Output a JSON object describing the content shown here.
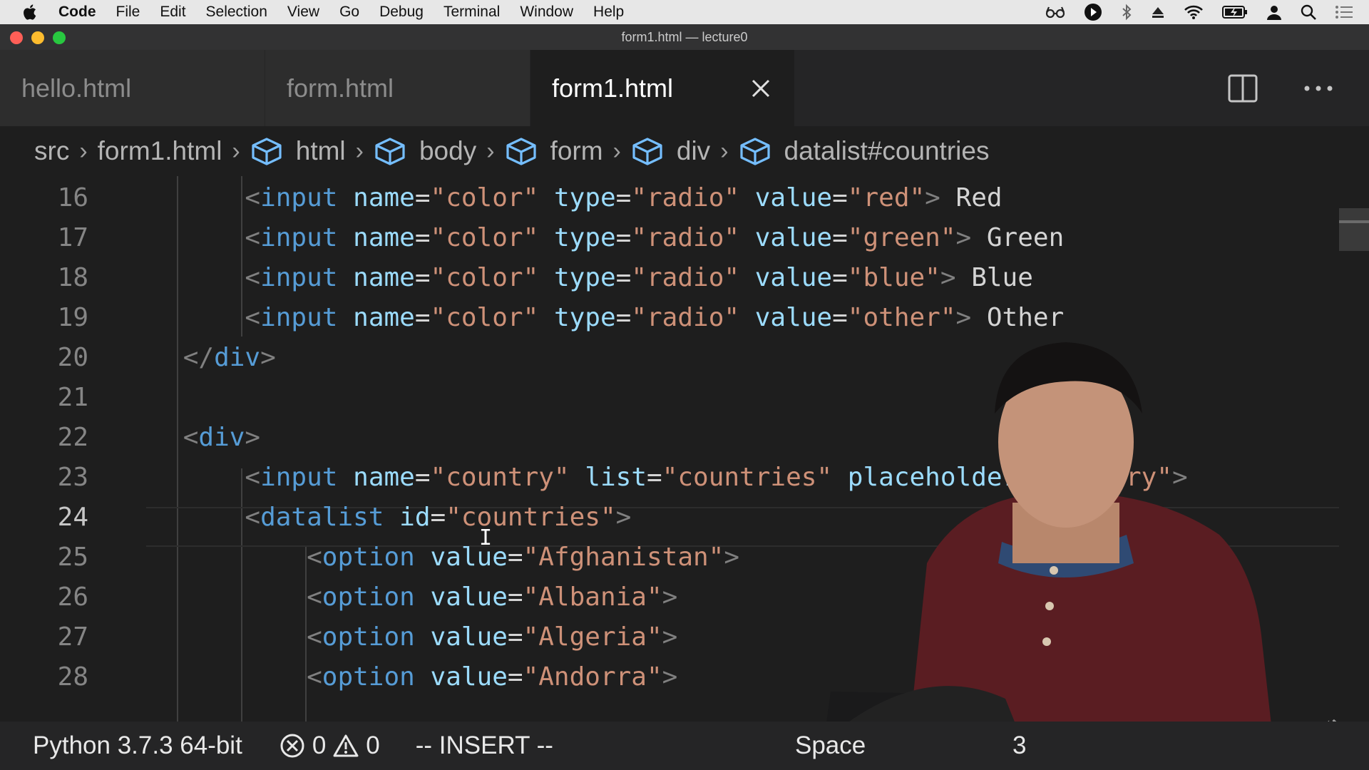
{
  "menubar": {
    "app_name": "Code",
    "items": [
      "File",
      "Edit",
      "Selection",
      "View",
      "Go",
      "Debug",
      "Terminal",
      "Window",
      "Help"
    ]
  },
  "window": {
    "title": "form1.html — lecture0"
  },
  "tabs": [
    {
      "label": "hello.html",
      "active": false
    },
    {
      "label": "form.html",
      "active": false
    },
    {
      "label": "form1.html",
      "active": true
    }
  ],
  "breadcrumb": [
    "src",
    "form1.html",
    "html",
    "body",
    "form",
    "div",
    "datalist#countries"
  ],
  "editor": {
    "current_line": 24,
    "lines": [
      {
        "num": "16",
        "indent": "        ",
        "parts": [
          [
            "punc",
            "<"
          ],
          [
            "tag",
            "input"
          ],
          [
            "txt",
            " "
          ],
          [
            "attr",
            "name"
          ],
          [
            "txt",
            "="
          ],
          [
            "str",
            "\"color\""
          ],
          [
            "txt",
            " "
          ],
          [
            "attr",
            "type"
          ],
          [
            "txt",
            "="
          ],
          [
            "str",
            "\"radio\""
          ],
          [
            "txt",
            " "
          ],
          [
            "attr",
            "value"
          ],
          [
            "txt",
            "="
          ],
          [
            "str",
            "\"red\""
          ],
          [
            "punc",
            ">"
          ],
          [
            "txt",
            " Red"
          ]
        ]
      },
      {
        "num": "17",
        "indent": "        ",
        "parts": [
          [
            "punc",
            "<"
          ],
          [
            "tag",
            "input"
          ],
          [
            "txt",
            " "
          ],
          [
            "attr",
            "name"
          ],
          [
            "txt",
            "="
          ],
          [
            "str",
            "\"color\""
          ],
          [
            "txt",
            " "
          ],
          [
            "attr",
            "type"
          ],
          [
            "txt",
            "="
          ],
          [
            "str",
            "\"radio\""
          ],
          [
            "txt",
            " "
          ],
          [
            "attr",
            "value"
          ],
          [
            "txt",
            "="
          ],
          [
            "str",
            "\"green\""
          ],
          [
            "punc",
            ">"
          ],
          [
            "txt",
            " Green"
          ]
        ]
      },
      {
        "num": "18",
        "indent": "        ",
        "parts": [
          [
            "punc",
            "<"
          ],
          [
            "tag",
            "input"
          ],
          [
            "txt",
            " "
          ],
          [
            "attr",
            "name"
          ],
          [
            "txt",
            "="
          ],
          [
            "str",
            "\"color\""
          ],
          [
            "txt",
            " "
          ],
          [
            "attr",
            "type"
          ],
          [
            "txt",
            "="
          ],
          [
            "str",
            "\"radio\""
          ],
          [
            "txt",
            " "
          ],
          [
            "attr",
            "value"
          ],
          [
            "txt",
            "="
          ],
          [
            "str",
            "\"blue\""
          ],
          [
            "punc",
            ">"
          ],
          [
            "txt",
            " Blue"
          ]
        ]
      },
      {
        "num": "19",
        "indent": "        ",
        "parts": [
          [
            "punc",
            "<"
          ],
          [
            "tag",
            "input"
          ],
          [
            "txt",
            " "
          ],
          [
            "attr",
            "name"
          ],
          [
            "txt",
            "="
          ],
          [
            "str",
            "\"color\""
          ],
          [
            "txt",
            " "
          ],
          [
            "attr",
            "type"
          ],
          [
            "txt",
            "="
          ],
          [
            "str",
            "\"radio\""
          ],
          [
            "txt",
            " "
          ],
          [
            "attr",
            "value"
          ],
          [
            "txt",
            "="
          ],
          [
            "str",
            "\"other\""
          ],
          [
            "punc",
            ">"
          ],
          [
            "txt",
            " Other"
          ]
        ]
      },
      {
        "num": "20",
        "indent": "    ",
        "parts": [
          [
            "punc",
            "</"
          ],
          [
            "tag",
            "div"
          ],
          [
            "punc",
            ">"
          ]
        ]
      },
      {
        "num": "21",
        "indent": "",
        "parts": []
      },
      {
        "num": "22",
        "indent": "    ",
        "parts": [
          [
            "punc",
            "<"
          ],
          [
            "tag",
            "div"
          ],
          [
            "punc",
            ">"
          ]
        ]
      },
      {
        "num": "23",
        "indent": "        ",
        "parts": [
          [
            "punc",
            "<"
          ],
          [
            "tag",
            "input"
          ],
          [
            "txt",
            " "
          ],
          [
            "attr",
            "name"
          ],
          [
            "txt",
            "="
          ],
          [
            "str",
            "\"country\""
          ],
          [
            "txt",
            " "
          ],
          [
            "attr",
            "list"
          ],
          [
            "txt",
            "="
          ],
          [
            "str",
            "\"countries\""
          ],
          [
            "txt",
            " "
          ],
          [
            "attr",
            "placeholder"
          ],
          [
            "txt",
            "="
          ],
          [
            "str",
            "\"Country\""
          ],
          [
            "punc",
            ">"
          ]
        ]
      },
      {
        "num": "24",
        "indent": "        ",
        "parts": [
          [
            "punc",
            "<"
          ],
          [
            "tag",
            "datalist"
          ],
          [
            "txt",
            " "
          ],
          [
            "attr",
            "id"
          ],
          [
            "txt",
            "="
          ],
          [
            "str",
            "\"countries\""
          ],
          [
            "punc",
            ">"
          ]
        ]
      },
      {
        "num": "25",
        "indent": "            ",
        "parts": [
          [
            "punc",
            "<"
          ],
          [
            "tag",
            "option"
          ],
          [
            "txt",
            " "
          ],
          [
            "attr",
            "value"
          ],
          [
            "txt",
            "="
          ],
          [
            "str",
            "\"Afghanistan\""
          ],
          [
            "punc",
            ">"
          ]
        ]
      },
      {
        "num": "26",
        "indent": "            ",
        "parts": [
          [
            "punc",
            "<"
          ],
          [
            "tag",
            "option"
          ],
          [
            "txt",
            " "
          ],
          [
            "attr",
            "value"
          ],
          [
            "txt",
            "="
          ],
          [
            "str",
            "\"Albania\""
          ],
          [
            "punc",
            ">"
          ]
        ]
      },
      {
        "num": "27",
        "indent": "            ",
        "parts": [
          [
            "punc",
            "<"
          ],
          [
            "tag",
            "option"
          ],
          [
            "txt",
            " "
          ],
          [
            "attr",
            "value"
          ],
          [
            "txt",
            "="
          ],
          [
            "str",
            "\"Algeria\""
          ],
          [
            "punc",
            ">"
          ]
        ]
      },
      {
        "num": "28",
        "indent": "            ",
        "parts": [
          [
            "punc",
            "<"
          ],
          [
            "tag",
            "option"
          ],
          [
            "txt",
            " "
          ],
          [
            "attr",
            "value"
          ],
          [
            "txt",
            "="
          ],
          [
            "str",
            "\"Andorra\""
          ],
          [
            "punc",
            ">"
          ]
        ]
      }
    ]
  },
  "statusbar": {
    "python": "Python 3.7.3 64-bit",
    "errors": "0",
    "warnings": "0",
    "mode": "-- INSERT --",
    "spaces": "Space",
    "spaces_tail": "3"
  },
  "colors": {
    "tag": "#569cd6",
    "attr": "#9cdcfe",
    "string": "#ce9178",
    "punctuation": "#808080",
    "editor_bg": "#1e1e1e"
  }
}
